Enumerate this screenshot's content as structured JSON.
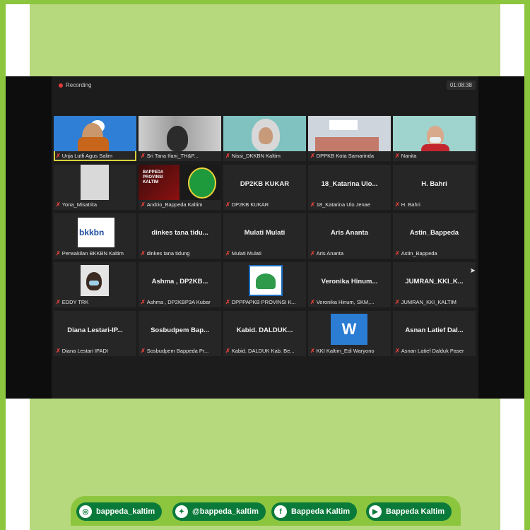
{
  "meeting": {
    "recording_label": "Recording",
    "timer": "01:08:38"
  },
  "tiles": [
    {
      "label": "Unja Lutfi Agus Salim",
      "center": "",
      "active": true
    },
    {
      "label": "Sri Tana Ifani_TH&P...",
      "center": ""
    },
    {
      "label": "Nissi_DKKBN Kaltim",
      "center": ""
    },
    {
      "label": "DPPKB Kota Samarinda",
      "center": ""
    },
    {
      "label": "Nanita",
      "center": ""
    },
    {
      "label": "Yona_Misatrita",
      "center": ""
    },
    {
      "label": "Andrio_Bappeda Kaltim",
      "center": ""
    },
    {
      "label": "DP2KB KUKAR",
      "center": "DP2KB KUKAR"
    },
    {
      "label": "18_Katarina Ulo Jenae",
      "center": "18_Katarina Ulo..."
    },
    {
      "label": "H. Bahri",
      "center": "H. Bahri"
    },
    {
      "label": "Perwakilan BKKBN Kaltim",
      "center": ""
    },
    {
      "label": "dinkes tana tidung",
      "center": "dinkes tana tidu..."
    },
    {
      "label": "Mulati Mulati",
      "center": "Mulati Mulati"
    },
    {
      "label": "Aris Ananta",
      "center": "Aris Ananta"
    },
    {
      "label": "Astin_Bappeda",
      "center": "Astin_Bappeda"
    },
    {
      "label": "EDDY TRK",
      "center": ""
    },
    {
      "label": "Ashma , DP2KBP3A Kubar",
      "center": "Ashma , DP2KB..."
    },
    {
      "label": "DPPPAPKB PROVINSI K...",
      "center": ""
    },
    {
      "label": "Veronika Hinum, SKM,...",
      "center": "Veronika Hinum..."
    },
    {
      "label": "JUMRAN_KKI_KALTIM",
      "center": "JUMRAN_KKI_K..."
    },
    {
      "label": "Diana Lestari IPADI",
      "center": "Diana Lestari-IP..."
    },
    {
      "label": "Sosbudpem Bappeda Pr...",
      "center": "Sosbudpem Bap..."
    },
    {
      "label": "Kabid. DALDUK Kab. Be...",
      "center": "Kabid. DALDUK..."
    },
    {
      "label": "KKI Kaltim_Edi Waryono",
      "center": ""
    },
    {
      "label": "Asnan Latief Dalduk Paser",
      "center": "Asnan Latief Dal..."
    }
  ],
  "tile_content": {
    "bkkbn_text": "bkkbn",
    "banner_text": "BAPPEDA PROVINSI KALTIM",
    "word_logo": "W"
  },
  "social": {
    "instagram": "bappeda_kaltim",
    "twitter": "@bappeda_kaltim",
    "facebook": "Bappeda Kaltim",
    "youtube": "Bappeda Kaltim"
  },
  "colors": {
    "frame_green": "#8cc63f",
    "panel_green": "#b7d97e",
    "pill_green": "#0a7a3a",
    "active_border": "#d9d23a",
    "muted_mic": "#e0413a"
  }
}
